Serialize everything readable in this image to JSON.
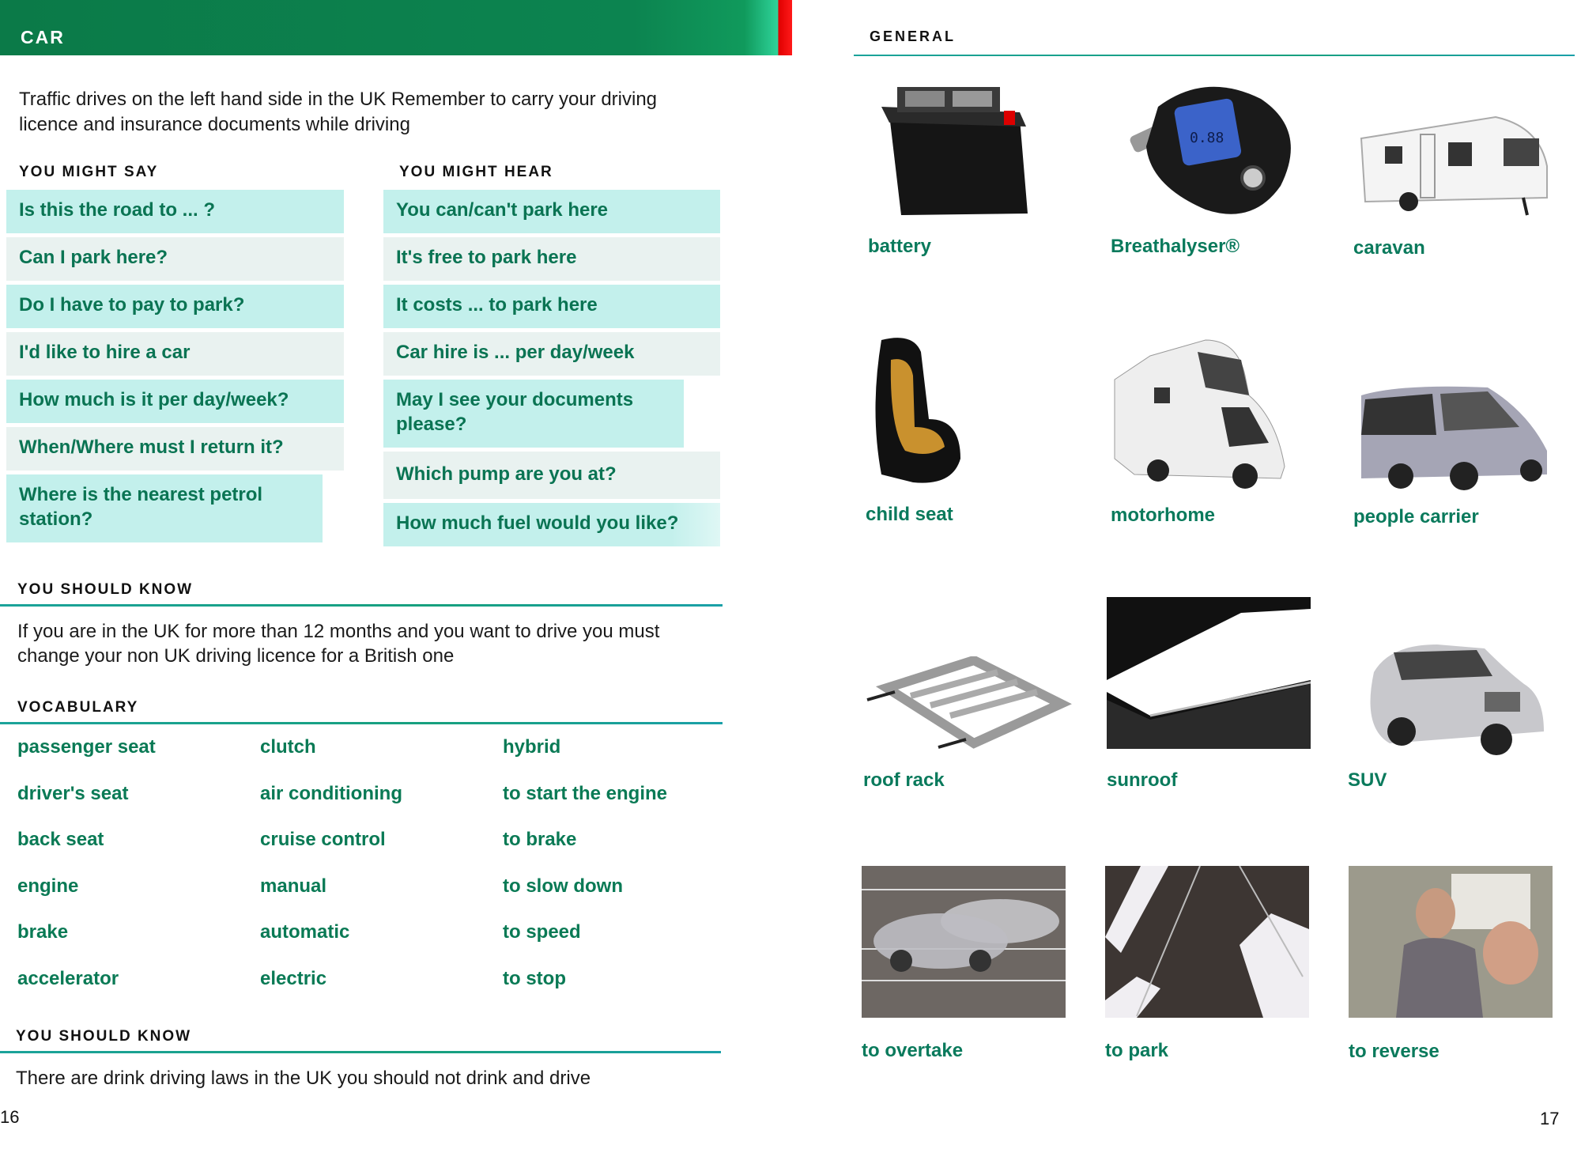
{
  "left_page": {
    "header": {
      "title": "CAR"
    },
    "intro": "Traffic drives on the left hand side in the UK Remember to carry your driving licence and insurance documents while driving",
    "you_might_say": {
      "label": "YOU MIGHT SAY",
      "phrases": [
        "Is this the road to ... ?",
        "Can I park here?",
        "Do I have to pay to park?",
        "I'd like to hire a car",
        "How much is it per day/week?",
        "When/Where must I return it?",
        "Where is the nearest petrol station?"
      ]
    },
    "you_might_hear": {
      "label": "YOU MIGHT HEAR",
      "phrases": [
        "You can/can't park here",
        "It's free to park here",
        "It costs ... to park here",
        "Car hire is ... per day/week",
        "May I see your documents please?",
        "Which pump are you at?",
        "How much fuel would you like?"
      ]
    },
    "you_should_know_1": {
      "label": "YOU SHOULD KNOW",
      "text": "If you are in the UK for more than 12 months and you want to drive you must change your non UK driving licence for a British one"
    },
    "vocabulary": {
      "label": "VOCABULARY",
      "items": [
        "passenger seat",
        "clutch",
        "hybrid",
        "driver's seat",
        "air conditioning",
        "to start the engine",
        "back seat",
        "cruise control",
        "to brake",
        "engine",
        "manual",
        "to slow down",
        "brake",
        "automatic",
        "to speed",
        "accelerator",
        "electric",
        "to stop"
      ]
    },
    "you_should_know_2": {
      "label": "YOU SHOULD KNOW",
      "text": "There are drink driving laws in the UK you should not drink and drive"
    },
    "page_number": "16"
  },
  "right_page": {
    "section_label": "GENERAL",
    "items": [
      {
        "label": "battery",
        "icon": "battery-image"
      },
      {
        "label": "Breathalyser®",
        "icon": "breathalyser-image"
      },
      {
        "label": "caravan",
        "icon": "caravan-image"
      },
      {
        "label": "child seat",
        "icon": "child-seat-image"
      },
      {
        "label": "motorhome",
        "icon": "motorhome-image"
      },
      {
        "label": "people carrier",
        "icon": "people-carrier-image"
      },
      {
        "label": "roof rack",
        "icon": "roof-rack-image"
      },
      {
        "label": "sunroof",
        "icon": "sunroof-image"
      },
      {
        "label": "SUV",
        "icon": "suv-image"
      },
      {
        "label": "to overtake",
        "icon": "overtake-photo"
      },
      {
        "label": "to park",
        "icon": "park-photo"
      },
      {
        "label": "to reverse",
        "icon": "reverse-photo"
      }
    ],
    "page_number": "17",
    "breathalyser_display": "0.88"
  },
  "colors": {
    "brand_green": "#0b7a48",
    "accent_red": "#ff1a1a",
    "phrase_green": "#0a7453",
    "row_cyan": "#c3f0ec",
    "row_gray": "#e9f2f0",
    "rule_teal": "#1ba39a"
  }
}
